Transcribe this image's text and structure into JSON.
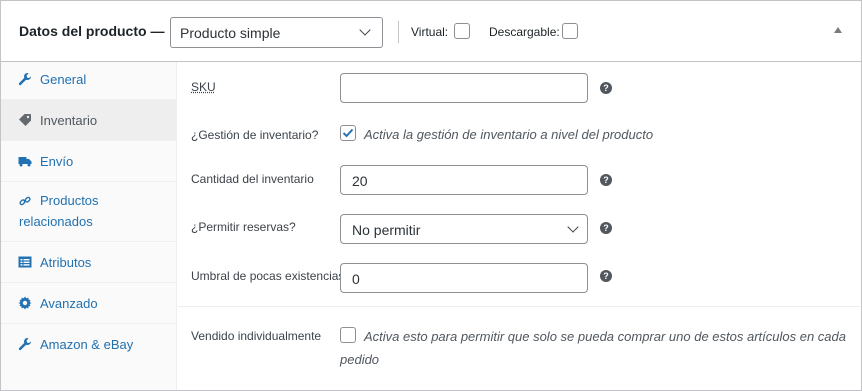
{
  "header": {
    "title": "Datos del producto —",
    "product_type": "Producto simple",
    "virtual_label": "Virtual:",
    "downloadable_label": "Descargable:"
  },
  "tabs": [
    {
      "label": "General",
      "icon": "wrench-icon"
    },
    {
      "label": "Inventario",
      "icon": "tag-icon",
      "active": true
    },
    {
      "label": "Envío",
      "icon": "truck-icon"
    },
    {
      "label_line1": "Productos",
      "label_line2": "relacionados",
      "icon": "link-icon"
    },
    {
      "label": "Atributos",
      "icon": "list-icon"
    },
    {
      "label": "Avanzado",
      "icon": "gear-icon"
    },
    {
      "label": "Amazon & eBay",
      "icon": "wrench-icon"
    }
  ],
  "form": {
    "sku_label": "SKU",
    "sku_value": "",
    "manage_stock_label": "¿Gestión de inventario?",
    "manage_stock_desc": "Activa la gestión de inventario a nivel del producto",
    "manage_stock_checked": true,
    "stock_qty_label": "Cantidad del inventario",
    "stock_qty_value": "20",
    "backorders_label": "¿Permitir reservas?",
    "backorders_value": "No permitir",
    "low_stock_label": "Umbral de pocas existencias",
    "low_stock_value": "0",
    "sold_individually_label": "Vendido individualmente",
    "sold_individually_desc_line1": "Activa esto para permitir que solo se pueda comprar uno de estos artículos en cada",
    "sold_individually_desc_line2": "pedido"
  },
  "colors": {
    "link": "#2271b1",
    "checkmark": "#2271b1",
    "border": "#8c8f94"
  }
}
